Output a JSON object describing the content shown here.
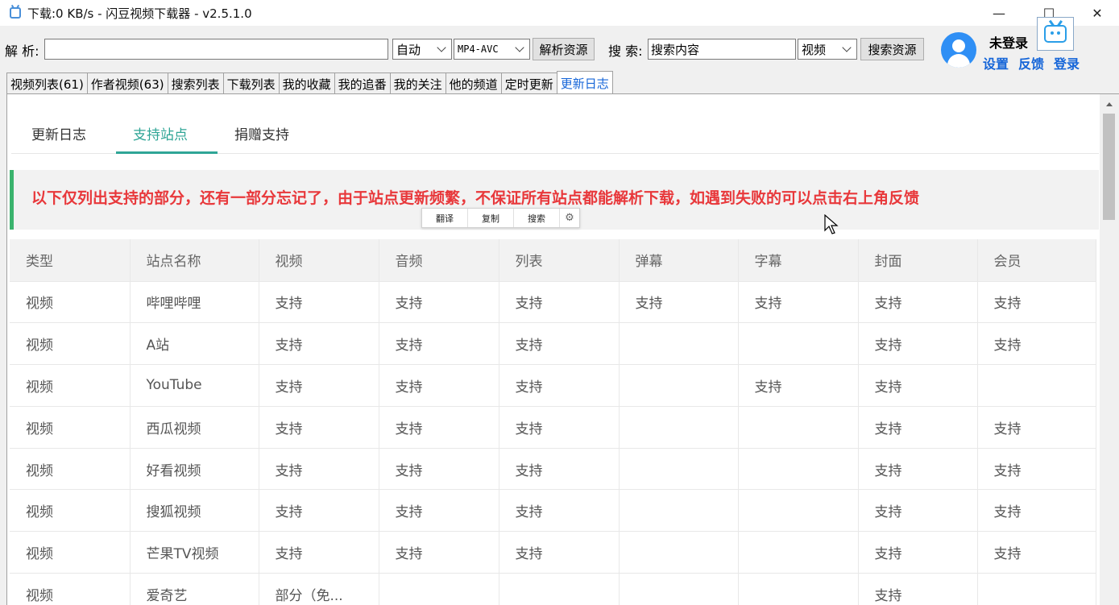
{
  "window": {
    "title": "下载:0 KB/s - 闪豆视频下载器 - v2.5.1.0",
    "minimize": "—",
    "maximize": "☐",
    "close": "✕"
  },
  "toolbar": {
    "parse_label": "解 析:",
    "parse_value": "",
    "mode_select": "自动",
    "format_select": "MP4-AVC",
    "parse_button": "解析资源",
    "search_label": "搜 索:",
    "search_value": "搜索内容",
    "search_type_select": "视频",
    "search_button": "搜索资源"
  },
  "user": {
    "status": "未登录",
    "links": [
      "设置",
      "反馈",
      "登录"
    ]
  },
  "main_tabs": [
    "视频列表(61)",
    "作者视频(63)",
    "搜索列表",
    "下载列表",
    "我的收藏",
    "我的追番",
    "我的关注",
    "他的频道",
    "定时更新",
    "更新日志"
  ],
  "active_main_tab": "更新日志",
  "sub_tabs": [
    "更新日志",
    "支持站点",
    "捐赠支持"
  ],
  "active_sub_tab": "支持站点",
  "notice": "以下仅列出支持的部分，还有一部分忘记了，由于站点更新频繁，不保证所有站点都能解析下载，如遇到失败的可以点击右上角反馈",
  "popup": {
    "items": [
      "翻译",
      "复制",
      "搜索"
    ],
    "gear": "⚙"
  },
  "table": {
    "headers": [
      "类型",
      "站点名称",
      "视频",
      "音频",
      "列表",
      "弹幕",
      "字幕",
      "封面",
      "会员"
    ],
    "rows": [
      [
        "视频",
        "哔哩哔哩",
        "支持",
        "支持",
        "支持",
        "支持",
        "支持",
        "支持",
        "支持"
      ],
      [
        "视频",
        "A站",
        "支持",
        "支持",
        "支持",
        "",
        "",
        "支持",
        "支持"
      ],
      [
        "视频",
        "YouTube",
        "支持",
        "支持",
        "支持",
        "",
        "支持",
        "支持",
        ""
      ],
      [
        "视频",
        "西瓜视频",
        "支持",
        "支持",
        "支持",
        "",
        "",
        "支持",
        "支持"
      ],
      [
        "视频",
        "好看视频",
        "支持",
        "支持",
        "支持",
        "",
        "",
        "支持",
        "支持"
      ],
      [
        "视频",
        "搜狐视频",
        "支持",
        "支持",
        "支持",
        "",
        "",
        "支持",
        "支持"
      ],
      [
        "视频",
        "芒果TV视频",
        "支持",
        "支持",
        "支持",
        "",
        "",
        "支持",
        "支持"
      ],
      [
        "视频",
        "爱奇艺",
        "部分（免...",
        "",
        "",
        "",
        "",
        "支持",
        ""
      ]
    ]
  },
  "colors": {
    "accent_teal": "#2fa596",
    "notice_red": "#e8383b",
    "notice_bar_green": "#3ab36d",
    "link_blue": "#1565d8",
    "avatar_blue": "#2f8ff5"
  }
}
